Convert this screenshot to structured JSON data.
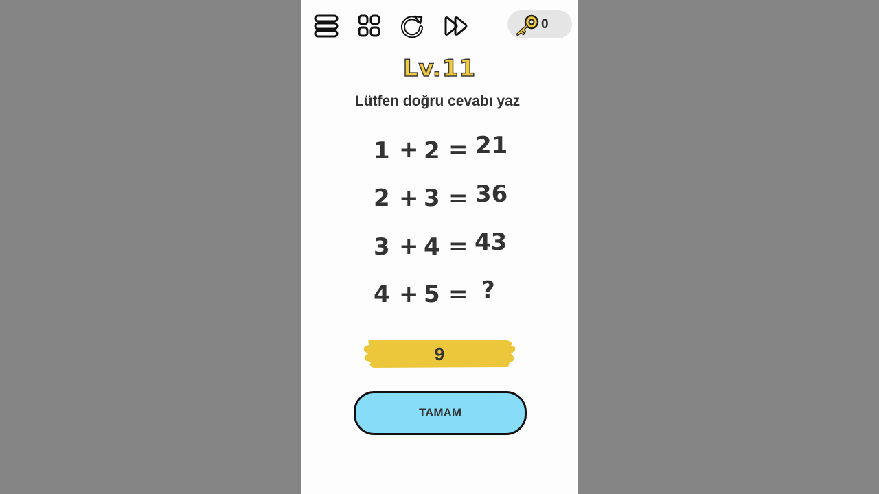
{
  "toolbar": {
    "icons": [
      "menu-icon",
      "level-grid-icon",
      "restart-icon",
      "skip-icon"
    ],
    "keys_count": "0"
  },
  "level": {
    "title": "Lv.11"
  },
  "instruction": "Lütfen doğru cevabı yaz",
  "equations": [
    {
      "a": "1",
      "plus": "+",
      "b": "2",
      "eq": "=",
      "result": "21"
    },
    {
      "a": "2",
      "plus": "+",
      "b": "3",
      "eq": "=",
      "result": "36"
    },
    {
      "a": "3",
      "plus": "+",
      "b": "4",
      "eq": "=",
      "result": "43"
    },
    {
      "a": "4",
      "plus": "+",
      "b": "5",
      "eq": "=",
      "result": "?"
    }
  ],
  "answer": {
    "value": "9"
  },
  "ok_button": {
    "label": "TAMAM"
  },
  "colors": {
    "background": "#848484",
    "panel": "#fdfdfd",
    "level_yellow": "#f0c93c",
    "answer_yellow": "#ecc73c",
    "button_blue": "#87dcf7"
  }
}
